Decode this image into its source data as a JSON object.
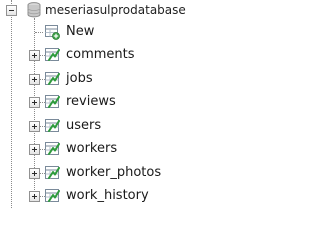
{
  "navigation_tree": {
    "database": {
      "name": "meseriasulprodatabase",
      "icon": "database-icon",
      "expanded": true
    },
    "new_item": {
      "label": "New",
      "icon": "new-table-icon"
    },
    "tables": [
      {
        "name": "comments",
        "icon": "table-icon",
        "expanded": false
      },
      {
        "name": "jobs",
        "icon": "table-icon",
        "expanded": false
      },
      {
        "name": "reviews",
        "icon": "table-icon",
        "expanded": false
      },
      {
        "name": "users",
        "icon": "table-icon",
        "expanded": false
      },
      {
        "name": "workers",
        "icon": "table-icon",
        "expanded": false
      },
      {
        "name": "worker_photos",
        "icon": "table-icon",
        "expanded": false
      },
      {
        "name": "work_history",
        "icon": "table-icon",
        "expanded": false
      }
    ],
    "colors": {
      "tree_line": "#8a8a8a",
      "table_icon_accent": "#2e9b3c",
      "text": "#1a1a1a"
    }
  }
}
